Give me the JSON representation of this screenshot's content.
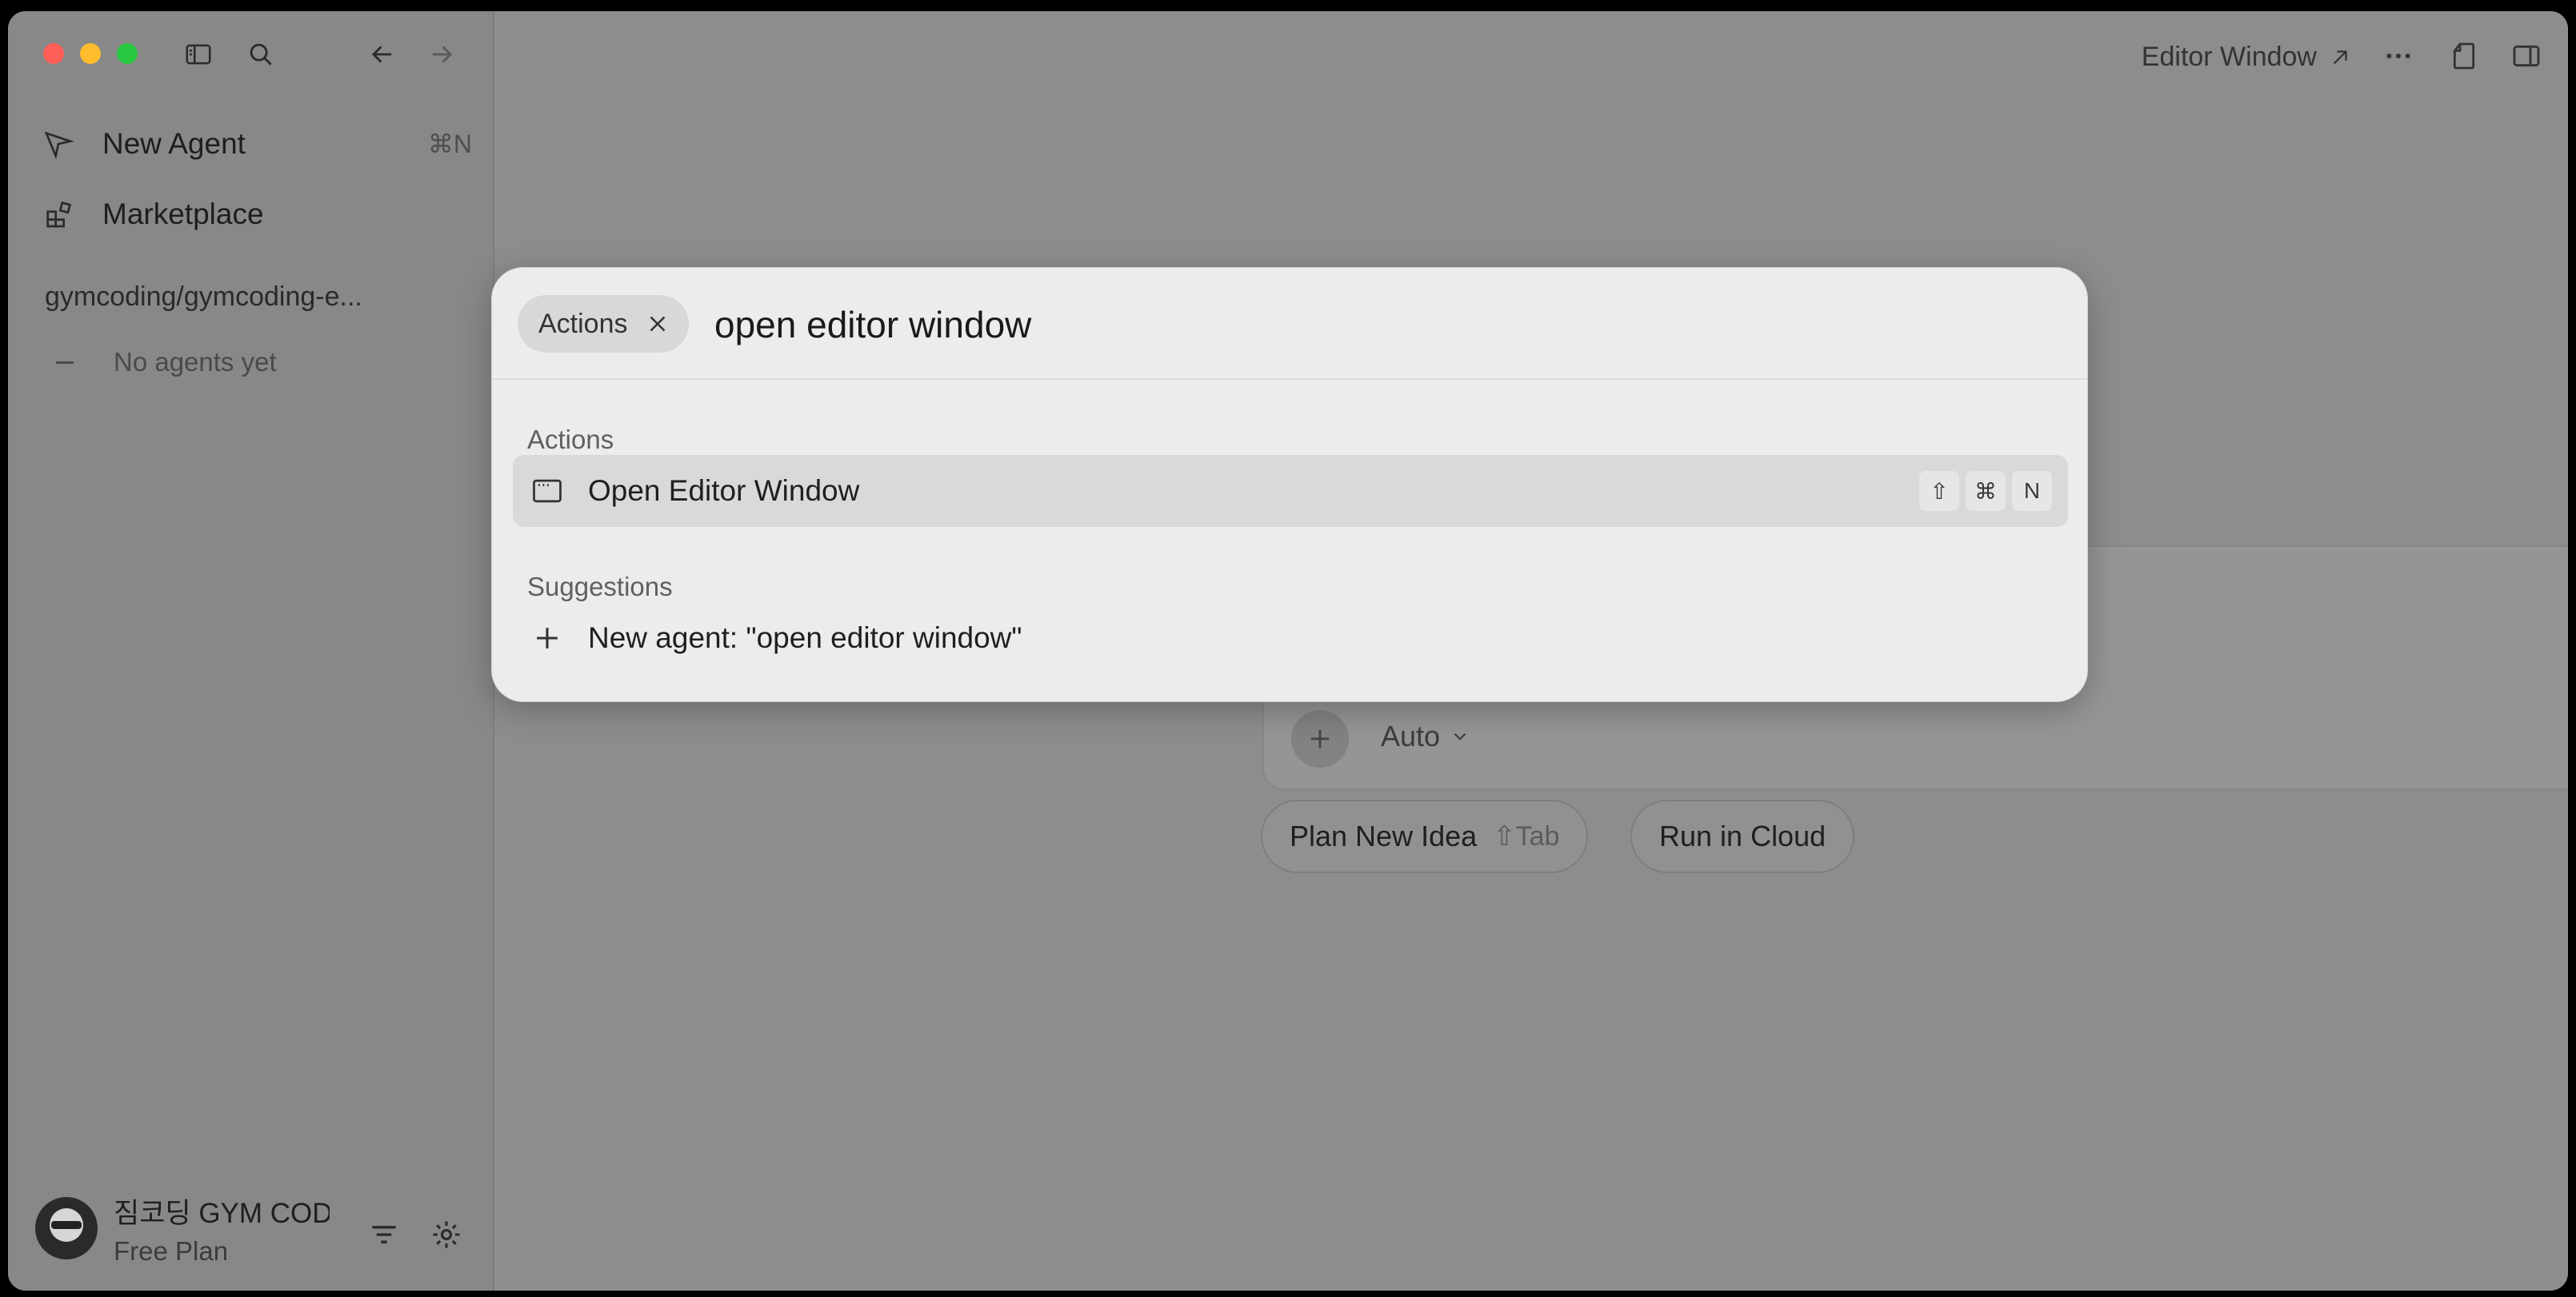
{
  "sidebar": {
    "new_agent": {
      "label": "New Agent",
      "shortcut": "⌘N"
    },
    "marketplace": {
      "label": "Marketplace"
    },
    "repo": "gymcoding/gymcoding-e...",
    "no_agents": "No agents yet",
    "user": {
      "name": "짐코딩 GYM CODING",
      "plan": "Free Plan"
    }
  },
  "topbar": {
    "editor_window": "Editor Window"
  },
  "composer": {
    "model": "Auto"
  },
  "quick_actions": {
    "plan": {
      "label": "Plan New Idea",
      "hint": "⇧Tab"
    },
    "cloud": {
      "label": "Run in Cloud"
    }
  },
  "palette": {
    "chip": "Actions",
    "query": "open editor window",
    "actions_header": "Actions",
    "action_item": {
      "label": "Open Editor Window",
      "keys": [
        "⇧",
        "⌘",
        "N"
      ]
    },
    "suggestions_header": "Suggestions",
    "suggestion_item": {
      "label": "New agent: \"open editor window\""
    }
  },
  "colors": {
    "close": "#ff5f57",
    "minimize": "#febc2e",
    "zoom": "#28c840",
    "mic_button": "#111111"
  }
}
